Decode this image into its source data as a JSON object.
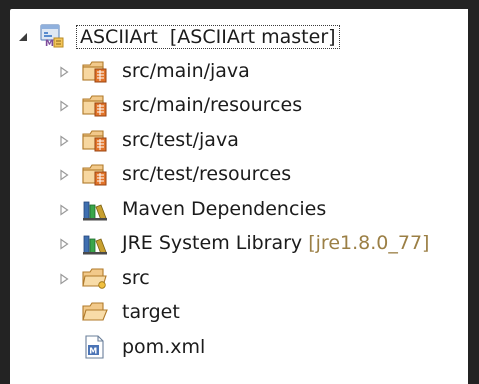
{
  "tree": {
    "root": {
      "label": "ASCIIArt",
      "decoration": "[ASCIIArt master]",
      "icon": "maven-project-icon",
      "expanded": true
    },
    "items": [
      {
        "label": "src/main/java",
        "icon": "source-folder-icon",
        "expandable": true
      },
      {
        "label": "src/main/resources",
        "icon": "source-folder-icon",
        "expandable": true
      },
      {
        "label": "src/test/java",
        "icon": "source-folder-icon",
        "expandable": true
      },
      {
        "label": "src/test/resources",
        "icon": "source-folder-icon",
        "expandable": true
      },
      {
        "label": "Maven Dependencies",
        "icon": "library-icon",
        "expandable": true
      },
      {
        "label": "JRE System Library",
        "decoration": "[jre1.8.0_77]",
        "icon": "library-icon",
        "expandable": true
      },
      {
        "label": "src",
        "icon": "folder-icon",
        "expandable": true
      },
      {
        "label": "target",
        "icon": "open-folder-icon",
        "expandable": false
      },
      {
        "label": "pom.xml",
        "icon": "xml-file-icon",
        "expandable": false
      }
    ]
  },
  "colors": {
    "background": "#232323",
    "panel": "#ffffff",
    "decoration": "#9b7f45"
  }
}
